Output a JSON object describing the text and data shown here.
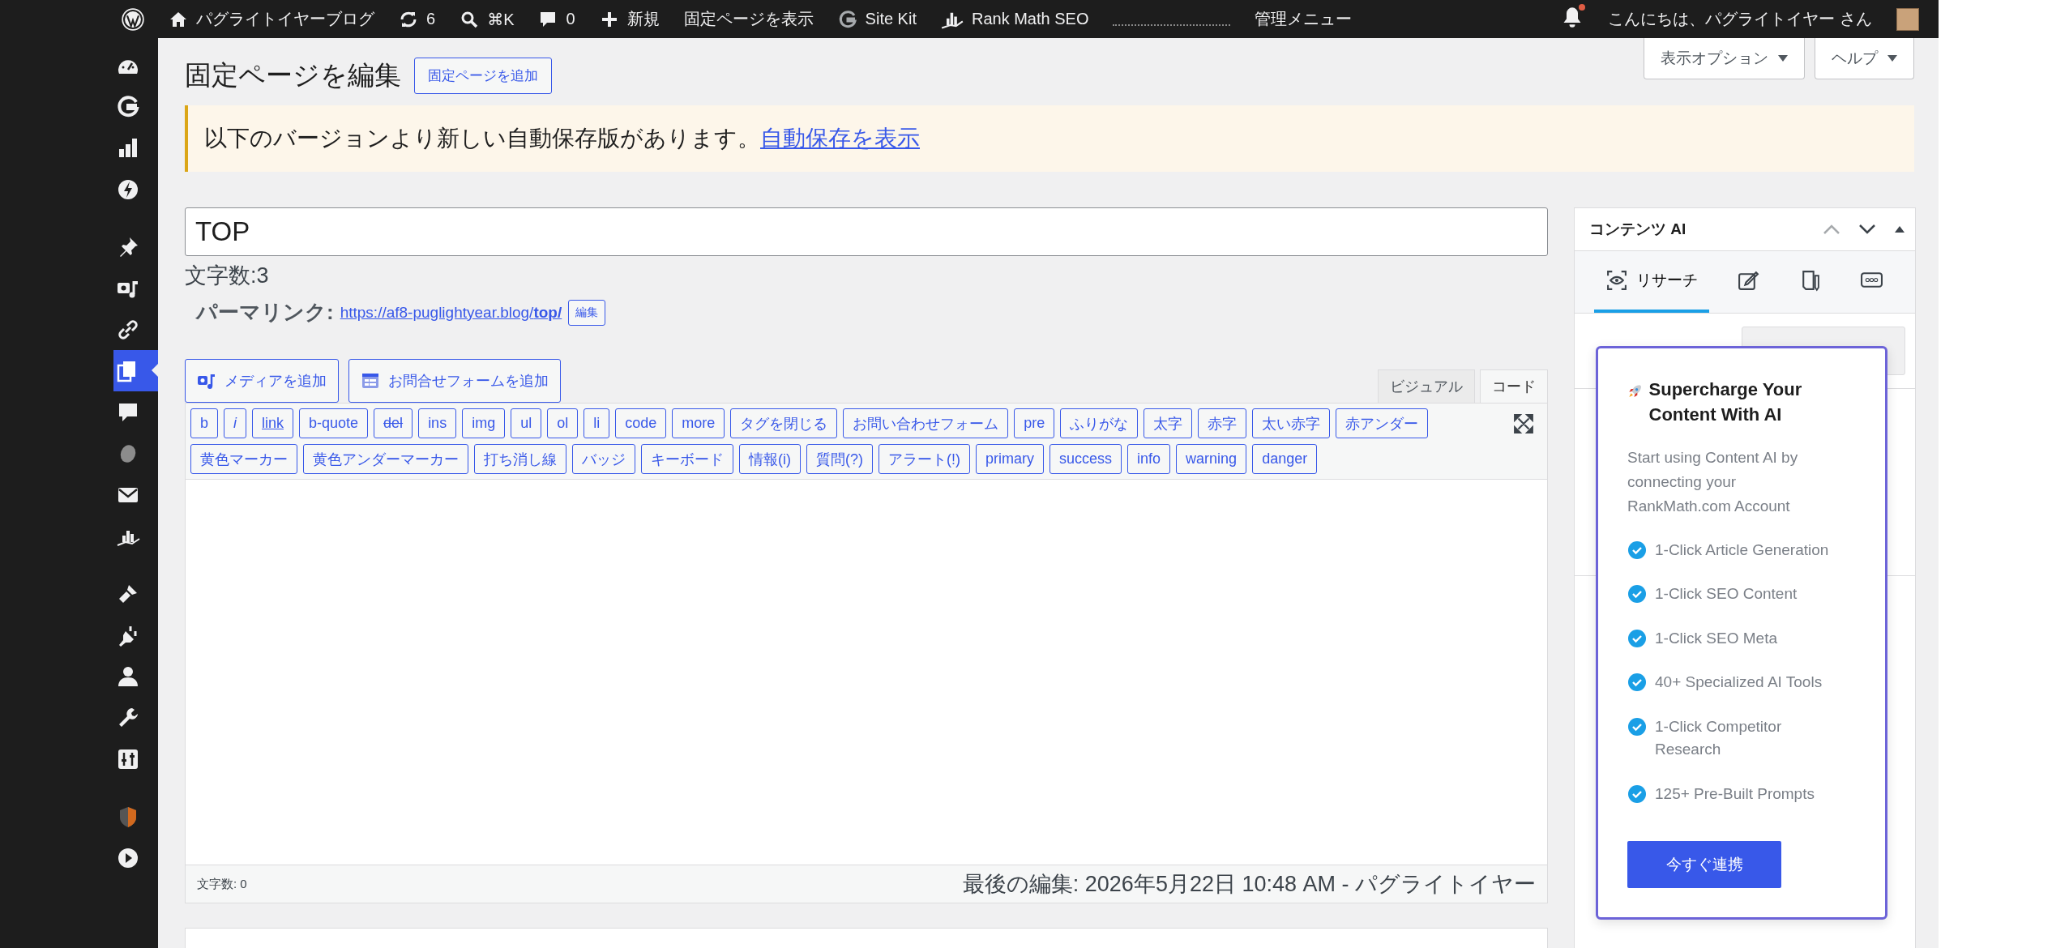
{
  "top_bar": {
    "site_name": "パグライトイヤーブログ",
    "updates": "6",
    "search_shortcut": "⌘K",
    "comments": "0",
    "new_label": "新規",
    "view_page": "固定ページを表示",
    "site_kit": "Site Kit",
    "rank_math": "Rank Math SEO",
    "admin_menu_label": "管理メニュー",
    "notifications_unread": true,
    "greeting": "こんにちは、パグライトイヤー さん"
  },
  "admin_menu": [
    {
      "selected": false
    },
    {
      "selected": false
    },
    {
      "selected": false
    },
    {
      "selected": false
    },
    {
      "selected": false
    },
    {
      "selected": false
    },
    {
      "selected": false
    },
    {
      "selected": true
    },
    {
      "selected": false
    },
    {
      "selected": false
    },
    {
      "selected": false
    },
    {
      "selected": false
    },
    {
      "selected": false
    },
    {
      "selected": false
    },
    {
      "selected": false
    },
    {
      "selected": false
    },
    {
      "selected": false
    },
    {
      "selected": false
    },
    {
      "selected": false
    }
  ],
  "screen_options": [
    "表示オプション",
    "ヘルプ"
  ],
  "page_title": "固定ページを編集",
  "add_new": "固定ページを追加",
  "notice": {
    "text": "以下のバージョンより新しい自動保存版があります。",
    "link": "自動保存を表示"
  },
  "post_title": "TOP",
  "title_count": "文字数:3",
  "permalink": {
    "label": "パーマリンク:",
    "url": "https://af8-puglightyear.blog/**top/**",
    "edit": "編集"
  },
  "media_buttons": [
    "メディアを追加",
    "お問合せフォームを追加"
  ],
  "editor_tabs": [
    {
      "label": "ビジュアル",
      "selected": false
    },
    {
      "label": "コード",
      "selected": true
    }
  ],
  "quicktags": [
    [
      {
        "label": "b",
        "kind": "plain"
      },
      {
        "label": "i",
        "kind": "italic"
      },
      {
        "label": "link",
        "kind": "underline"
      },
      {
        "label": "b-quote",
        "kind": "plain"
      },
      {
        "label": "del",
        "kind": "strike"
      },
      {
        "label": "ins",
        "kind": "plain"
      },
      {
        "label": "img",
        "kind": "plain"
      },
      {
        "label": "ul",
        "kind": "plain"
      },
      {
        "label": "ol",
        "kind": "plain"
      },
      {
        "label": "li",
        "kind": "plain"
      },
      {
        "label": "code",
        "kind": "plain"
      },
      {
        "label": "more",
        "kind": "plain"
      },
      {
        "label": "タグを閉じる",
        "kind": "plain"
      },
      {
        "label": "お問い合わせフォーム",
        "kind": "plain"
      },
      {
        "label": "pre",
        "kind": "plain"
      },
      {
        "label": "ふりがな",
        "kind": "plain"
      },
      {
        "label": "太字",
        "kind": "plain"
      },
      {
        "label": "赤字",
        "kind": "plain"
      },
      {
        "label": "太い赤字",
        "kind": "plain"
      },
      {
        "label": "赤アンダー",
        "kind": "plain"
      }
    ],
    [
      {
        "label": "黄色マーカー",
        "kind": "plain"
      },
      {
        "label": "黄色アンダーマーカー",
        "kind": "plain"
      },
      {
        "label": "打ち消し線",
        "kind": "plain"
      },
      {
        "label": "バッジ",
        "kind": "plain"
      },
      {
        "label": "キーボード",
        "kind": "plain"
      },
      {
        "label": "情報(i)",
        "kind": "plain"
      },
      {
        "label": "質問(?)",
        "kind": "plain"
      },
      {
        "label": "アラート(!)",
        "kind": "plain"
      },
      {
        "label": "primary",
        "kind": "plain"
      },
      {
        "label": "success",
        "kind": "plain"
      },
      {
        "label": "info",
        "kind": "plain"
      },
      {
        "label": "warning",
        "kind": "plain"
      },
      {
        "label": "danger",
        "kind": "plain"
      }
    ]
  ],
  "status_bar": {
    "word_count": "文字数: 0",
    "last_edit": "最後の編集: 2026年5月22日 10:48 AM - パグライトイヤー"
  },
  "content_ai": {
    "title": "コンテンツ AI",
    "tabs": [
      {
        "label": "リサーチ",
        "selected": true
      },
      {
        "selected": false
      },
      {
        "selected": false
      },
      {
        "selected": false
      }
    ],
    "popup": {
      "title": "Supercharge Your Content With AI",
      "description": "Start using Content AI by connecting your RankMath.com Account",
      "features": [
        "1-Click Article Generation",
        "1-Click SEO Content",
        "1-Click SEO Meta",
        "40+ Specialized AI Tools",
        "1-Click Competitor Research",
        "125+ Pre-Built Prompts"
      ],
      "button": "今すぐ連携"
    }
  }
}
